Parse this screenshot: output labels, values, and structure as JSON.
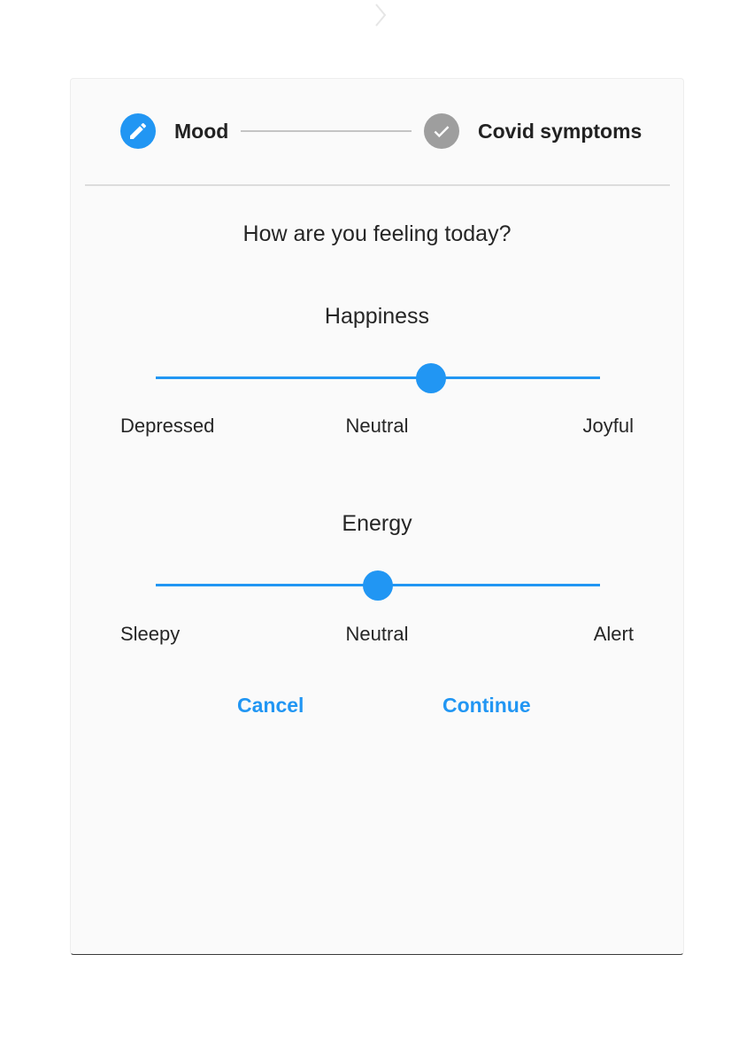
{
  "stepper": {
    "steps": [
      {
        "label": "Mood",
        "state": "editing",
        "icon": "pencil-icon"
      },
      {
        "label": "Covid symptoms",
        "state": "complete",
        "icon": "check-icon"
      }
    ]
  },
  "question": "How are you feeling today?",
  "sliders": [
    {
      "title": "Happiness",
      "value": 0.62,
      "labels": {
        "min": "Depressed",
        "mid": "Neutral",
        "max": "Joyful"
      }
    },
    {
      "title": "Energy",
      "value": 0.5,
      "labels": {
        "min": "Sleepy",
        "mid": "Neutral",
        "max": "Alert"
      }
    }
  ],
  "actions": {
    "cancel_label": "Cancel",
    "continue_label": "Continue"
  },
  "colors": {
    "accent": "#2196f3",
    "inactive_step": "#9e9e9e",
    "card_background": "#fafafa",
    "text": "#262626"
  }
}
